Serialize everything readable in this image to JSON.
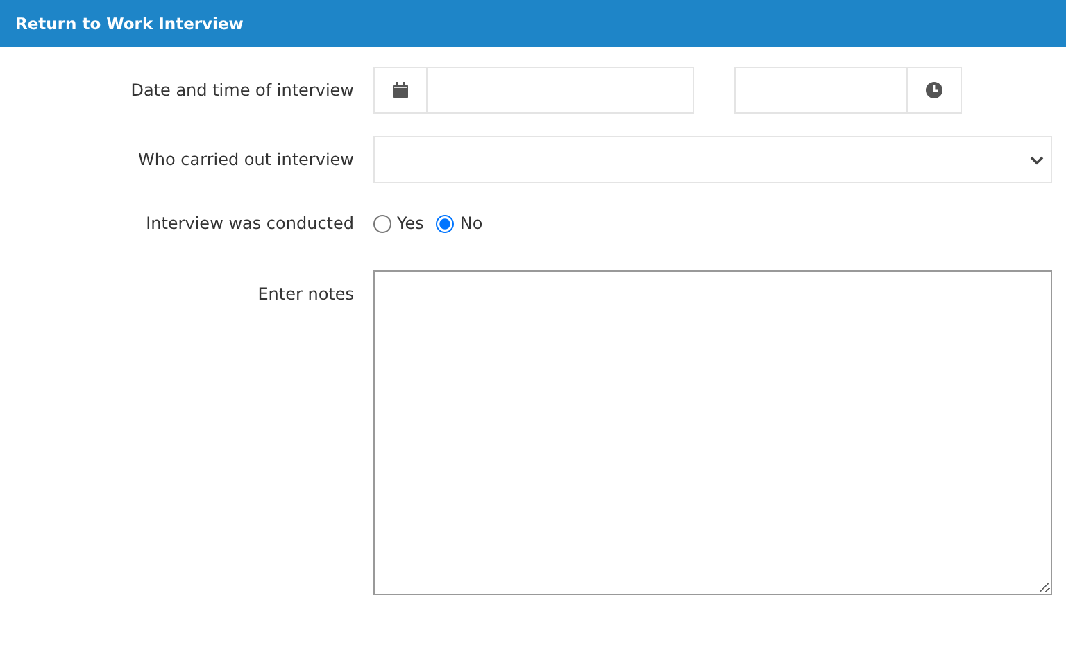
{
  "header": {
    "title": "Return to Work Interview"
  },
  "fields": [
    {
      "kind": "datetime",
      "label": "Date and time of interview"
    },
    {
      "kind": "select",
      "label": "Who carried out interview"
    },
    {
      "kind": "radio",
      "label": "Interview was conducted",
      "options": [
        {
          "label": "Yes",
          "selected": false
        },
        {
          "label": "No",
          "selected": true
        }
      ]
    },
    {
      "kind": "textarea",
      "label": "Enter notes"
    }
  ]
}
